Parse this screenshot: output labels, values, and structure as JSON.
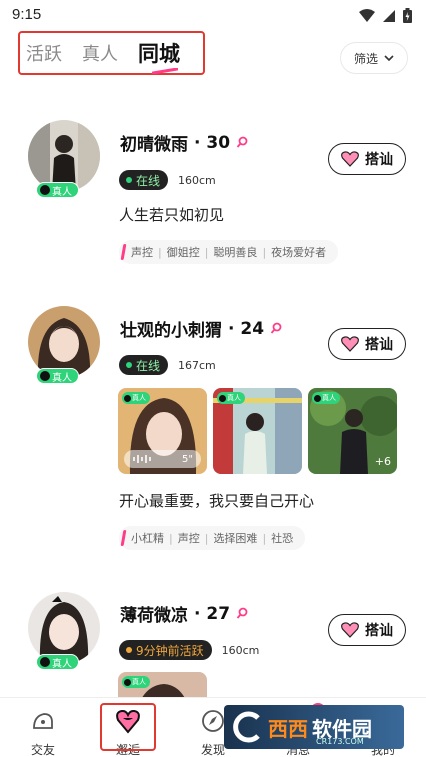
{
  "status_bar": {
    "time": "9:15"
  },
  "tabs": [
    {
      "label": "活跃",
      "active": false
    },
    {
      "label": "真人",
      "active": false
    },
    {
      "label": "同城",
      "active": true
    }
  ],
  "filter": {
    "label": "筛选"
  },
  "verify_label": "真人",
  "chat_label": "搭讪",
  "users": [
    {
      "name": "初晴微雨",
      "age": "· 30",
      "status": "在线",
      "height": "160cm",
      "bio": "人生若只如初见",
      "tags": [
        "声控",
        "御姐控",
        "聪明善良",
        "夜场爱好者"
      ]
    },
    {
      "name": "壮观的小刺猬",
      "age": "· 24",
      "status": "在线",
      "height": "167cm",
      "bio": "开心最重要，我只要自己开心",
      "photo_voice_duration": "5\"",
      "photo_more": "+6",
      "tags": [
        "小杠精",
        "声控",
        "选择困难",
        "社恐"
      ]
    },
    {
      "name": "薄荷微凉",
      "age": "· 27",
      "status": "9分钟前活跃",
      "height": "160cm"
    }
  ],
  "bottom_nav": [
    {
      "label": "交友",
      "active": false
    },
    {
      "label": "邂逅",
      "active": true
    },
    {
      "label": "发现",
      "active": false
    },
    {
      "label": "消息",
      "active": false
    },
    {
      "label": "我的",
      "active": false
    }
  ],
  "message_badge": "1",
  "watermark": {
    "main": "西西",
    "sub": "软件园",
    "url": "CR173.COM"
  },
  "colors": {
    "accent_pink": "#ff3c8a",
    "online_green": "#2fd37a",
    "highlight_red": "#e0392f"
  }
}
